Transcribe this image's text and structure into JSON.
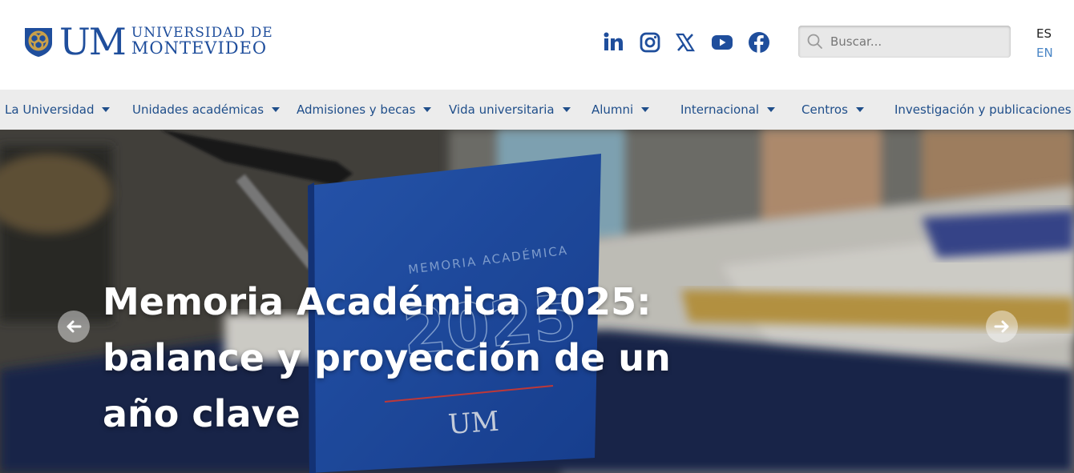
{
  "header": {
    "logo": {
      "mark": "UM",
      "line1": "UNIVERSIDAD DE",
      "line2": "MONTEVIDEO"
    },
    "social": [
      {
        "name": "linkedin",
        "icon": "linkedin-icon"
      },
      {
        "name": "instagram",
        "icon": "instagram-icon"
      },
      {
        "name": "x",
        "icon": "x-icon"
      },
      {
        "name": "youtube",
        "icon": "youtube-icon"
      },
      {
        "name": "facebook",
        "icon": "facebook-icon"
      }
    ],
    "search": {
      "placeholder": "Buscar...",
      "value": "",
      "icon": "search-icon"
    },
    "languages": {
      "current": "ES",
      "alternate": "EN"
    }
  },
  "nav": {
    "items": [
      {
        "label": "La Universidad"
      },
      {
        "label": "Unidades académicas"
      },
      {
        "label": "Admisiones y becas"
      },
      {
        "label": "Vida universitaria"
      },
      {
        "label": "Alumni"
      },
      {
        "label": "Internacional"
      },
      {
        "label": "Centros"
      },
      {
        "label": "Investigación y publicaciones"
      }
    ]
  },
  "hero": {
    "title": "Memoria Académica 2025: balance y proyección de un año clave",
    "prev_icon": "arrow-left-icon",
    "next_icon": "arrow-right-icon"
  },
  "colors": {
    "brand_blue": "#1f4e9c",
    "nav_text": "#1f4e8a",
    "nav_bg": "#ececec",
    "lang_alt": "#4a86c6"
  }
}
